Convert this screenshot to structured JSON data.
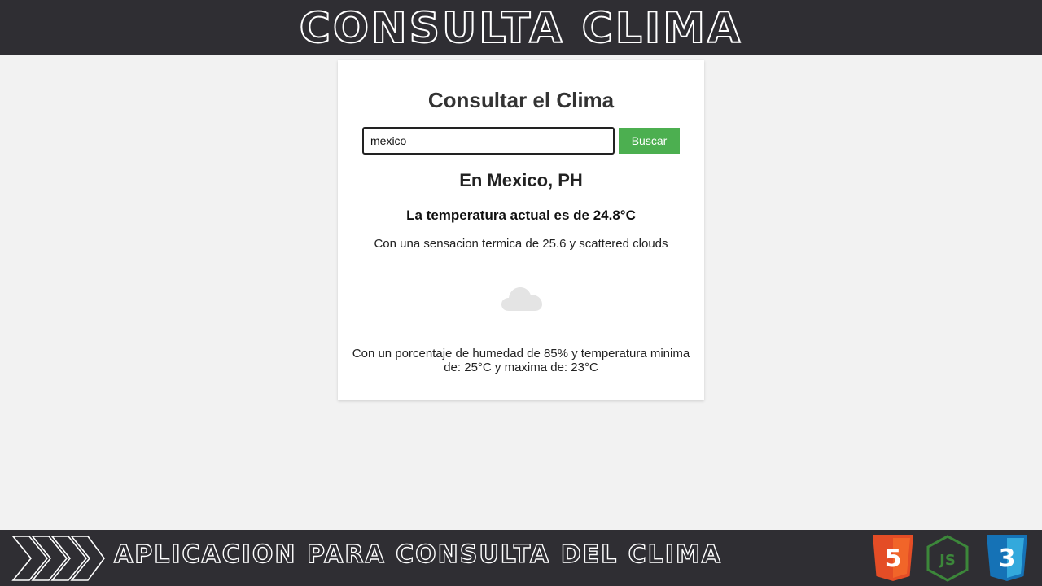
{
  "banner": {
    "title": "CONSULTA CLIMA"
  },
  "card": {
    "title": "Consultar el Clima",
    "search": {
      "value": "mexico",
      "placeholder": ""
    },
    "search_button_label": "Buscar",
    "location": "En Mexico, PH",
    "temperature_text": "La temperatura actual es de 24.8°C",
    "feels_like_text": "Con una sensacion termica de 25.6 y scattered clouds",
    "weather_icon": "cloud-icon",
    "humidity_text": "Con un porcentaje de humedad de 85% y temperatura minima de: 25°C y maxima de: 23°C"
  },
  "footer": {
    "text": "APLICACION PARA CONSULTA DEL CLIMA",
    "icons": [
      "chevrons-icon",
      "html5-logo",
      "nodejs-logo",
      "css3-logo"
    ],
    "logos": {
      "html5": "5",
      "nodejs": "JS",
      "css3": "3"
    }
  },
  "colors": {
    "banner_bg": "#2f2e33",
    "page_bg": "#f2f2f2",
    "button_bg": "#4caf50",
    "html5": "#e44d26",
    "nodejs": "#3c873a",
    "css3": "#1572b6"
  }
}
